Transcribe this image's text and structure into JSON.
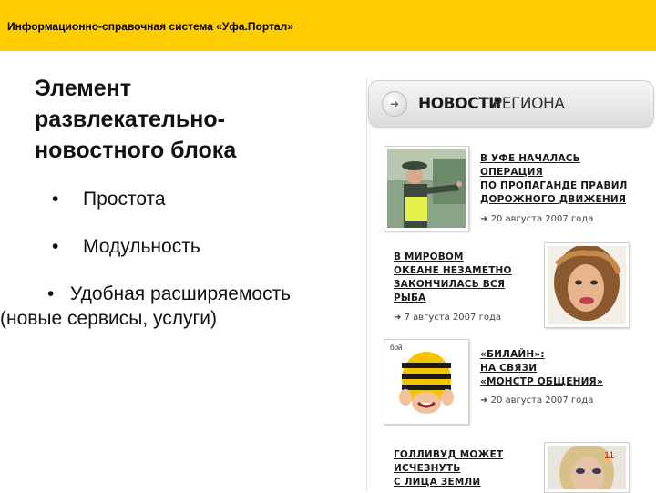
{
  "header": {
    "title": "Информационно-справочная система «Уфа.Портал»"
  },
  "slide": {
    "title": "Элемент развлекательно-новостного блока",
    "bullets": [
      {
        "mark": "•",
        "text": "Простота"
      },
      {
        "mark": "•",
        "text": "Модульность"
      },
      {
        "mark": "•",
        "text": "Удобная расширяемость",
        "text2": "(новые сервисы, услуги)"
      }
    ]
  },
  "news_block": {
    "title_bold": "НОВОСТИ",
    "title_light": "РЕГИОНА",
    "arrow_glyph": "➜",
    "items": [
      {
        "lines": [
          "В УФЕ НАЧАЛАСЬ",
          "ОПЕРАЦИЯ",
          "ПО ПРОПАГАНДЕ ПРАВИЛ",
          "ДОРОЖНОГО ДВИЖЕНИЯ"
        ],
        "date": "20 августа 2007 года",
        "date_icon": "➜"
      },
      {
        "lines": [
          "В МИРОВОМ",
          "ОКЕАНЕ НЕЗАМЕТНО",
          "ЗАКОНЧИЛАСЬ ВСЯ",
          "РЫБА"
        ],
        "date": "7 августа 2007 года",
        "date_icon": "➜"
      },
      {
        "lines": [
          "«БИЛАЙН»:",
          "НА СВЯЗИ",
          "«МОНСТР ОБЩЕНИЯ»"
        ],
        "date": "20 августа 2007 года",
        "date_icon": "➜"
      },
      {
        "lines": [
          "ГОЛЛИВУД МОЖЕТ",
          "ИСЧЕЗНУТЬ",
          "С ЛИЦА ЗЕМЛИ"
        ]
      }
    ],
    "beeline_caption": "бой"
  },
  "page_number": "11"
}
